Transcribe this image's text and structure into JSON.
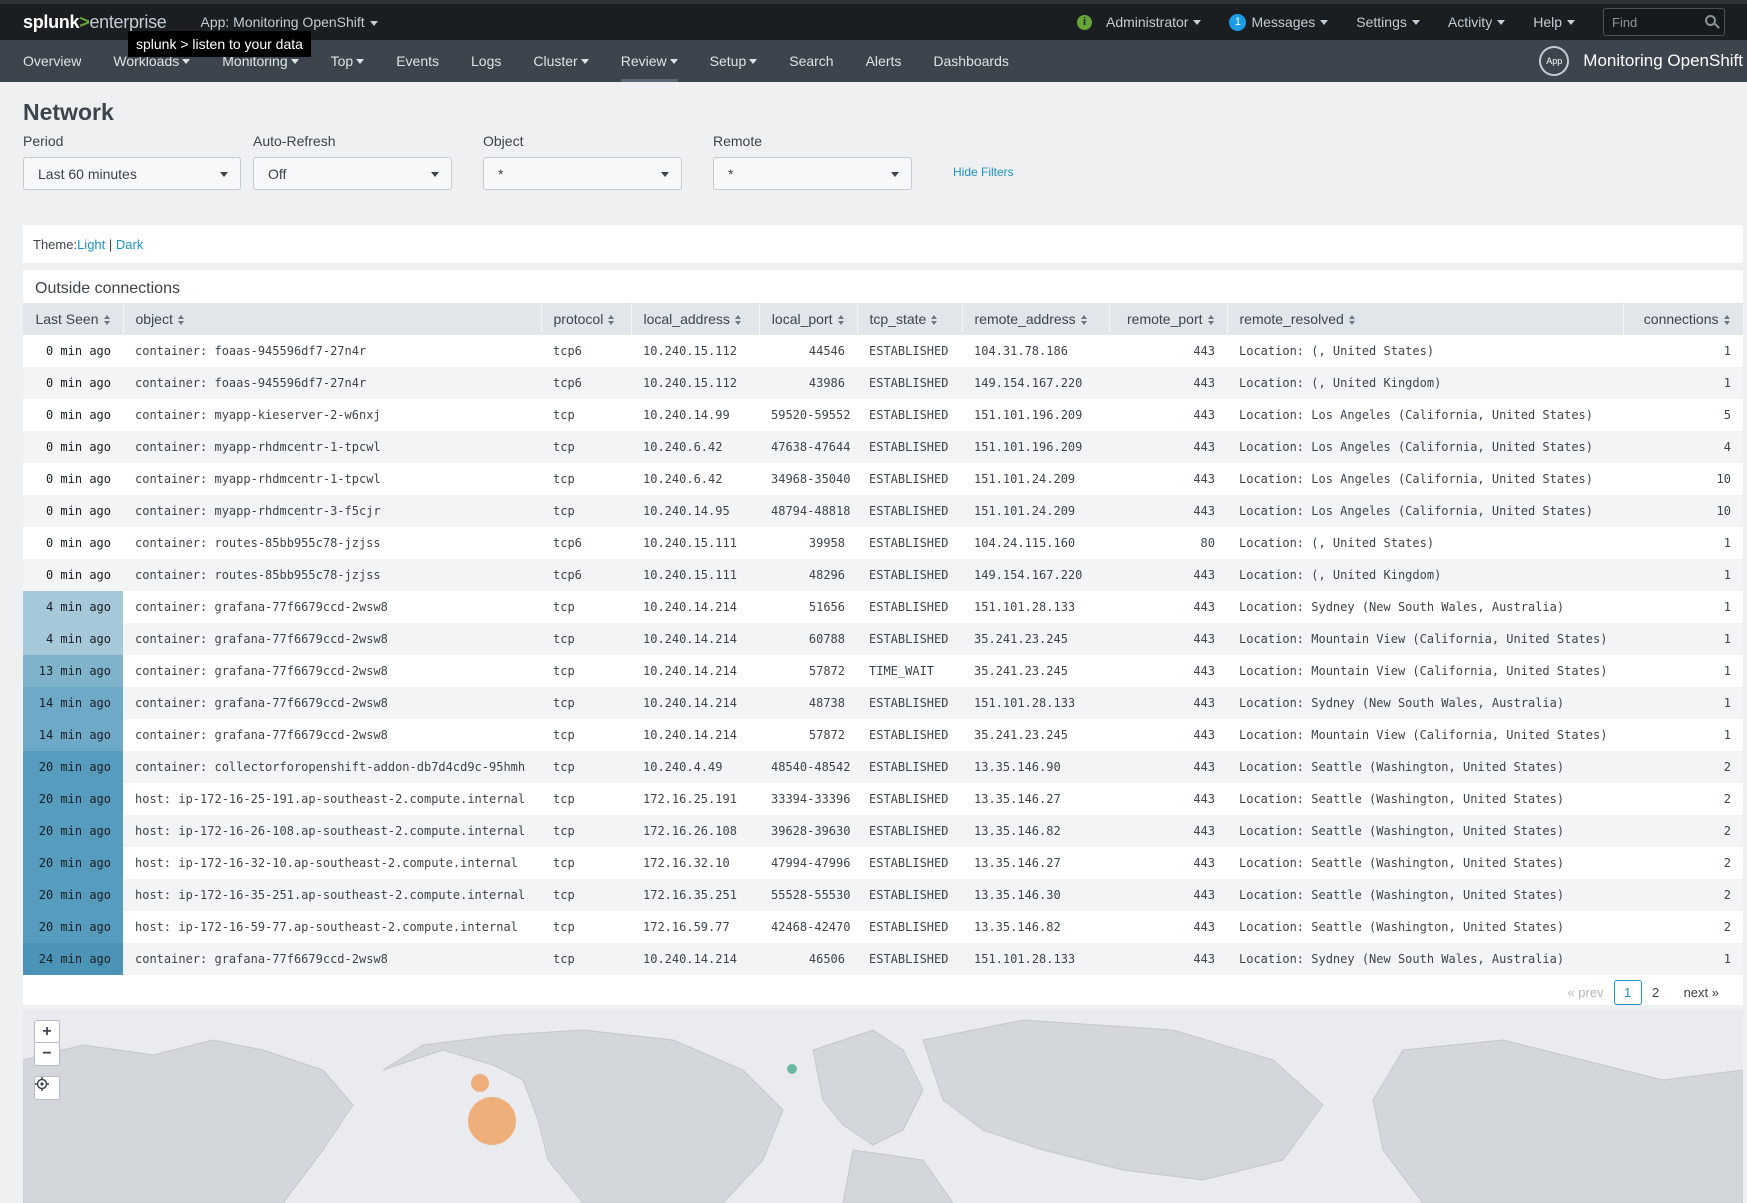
{
  "topbar": {
    "logo_main": "splunk",
    "logo_gt": ">",
    "logo_suffix": "enterprise",
    "app_label": "App: Monitoring OpenShift",
    "info_icon": "i",
    "user": "Administrator",
    "messages_count": "1",
    "messages": "Messages",
    "settings": "Settings",
    "activity": "Activity",
    "help": "Help",
    "find_placeholder": "Find"
  },
  "tooltip": "splunk > listen to your data",
  "nav": {
    "items": [
      {
        "label": "Overview",
        "caret": false
      },
      {
        "label": "Workloads",
        "caret": true
      },
      {
        "label": "Monitoring",
        "caret": true
      },
      {
        "label": "Top",
        "caret": true
      },
      {
        "label": "Events",
        "caret": false
      },
      {
        "label": "Logs",
        "caret": false
      },
      {
        "label": "Cluster",
        "caret": true
      },
      {
        "label": "Review",
        "caret": true
      },
      {
        "label": "Setup",
        "caret": true
      },
      {
        "label": "Search",
        "caret": false
      },
      {
        "label": "Alerts",
        "caret": false
      },
      {
        "label": "Dashboards",
        "caret": false
      }
    ],
    "app_badge": "App",
    "app_title": "Monitoring OpenShift"
  },
  "page": {
    "title": "Network",
    "filters": [
      {
        "label": "Period",
        "value": "Last 60 minutes"
      },
      {
        "label": "Auto-Refresh",
        "value": "Off"
      },
      {
        "label": "Object",
        "value": "*"
      },
      {
        "label": "Remote",
        "value": "*"
      }
    ],
    "hide_filters": "Hide Filters"
  },
  "theme": {
    "label": "Theme: ",
    "light": "Light",
    "separator": " | ",
    "dark": "Dark"
  },
  "table": {
    "title": "Outside connections",
    "columns": [
      "Last Seen",
      "object",
      "protocol",
      "local_address",
      "local_port",
      "tcp_state",
      "remote_address",
      "remote_port",
      "remote_resolved",
      "connections"
    ],
    "rows": [
      [
        "0 min ago",
        "container: foaas-945596df7-27n4r",
        "tcp6",
        "10.240.15.112",
        "44546",
        "ESTABLISHED",
        "104.31.78.186",
        "443",
        "Location:  (, United States)",
        "1"
      ],
      [
        "0 min ago",
        "container: foaas-945596df7-27n4r",
        "tcp6",
        "10.240.15.112",
        "43986",
        "ESTABLISHED",
        "149.154.167.220",
        "443",
        "Location:  (, United Kingdom)",
        "1"
      ],
      [
        "0 min ago",
        "container: myapp-kieserver-2-w6nxj",
        "tcp",
        "10.240.14.99",
        "59520-59552",
        "ESTABLISHED",
        "151.101.196.209",
        "443",
        "Location: Los Angeles (California, United States)",
        "5"
      ],
      [
        "0 min ago",
        "container: myapp-rhdmcentr-1-tpcwl",
        "tcp",
        "10.240.6.42",
        "47638-47644",
        "ESTABLISHED",
        "151.101.196.209",
        "443",
        "Location: Los Angeles (California, United States)",
        "4"
      ],
      [
        "0 min ago",
        "container: myapp-rhdmcentr-1-tpcwl",
        "tcp",
        "10.240.6.42",
        "34968-35040",
        "ESTABLISHED",
        "151.101.24.209",
        "443",
        "Location: Los Angeles (California, United States)",
        "10"
      ],
      [
        "0 min ago",
        "container: myapp-rhdmcentr-3-f5cjr",
        "tcp",
        "10.240.14.95",
        "48794-48818",
        "ESTABLISHED",
        "151.101.24.209",
        "443",
        "Location: Los Angeles (California, United States)",
        "10"
      ],
      [
        "0 min ago",
        "container: routes-85bb955c78-jzjss",
        "tcp6",
        "10.240.15.111",
        "39958",
        "ESTABLISHED",
        "104.24.115.160",
        "80",
        "Location:  (, United States)",
        "1"
      ],
      [
        "0 min ago",
        "container: routes-85bb955c78-jzjss",
        "tcp6",
        "10.240.15.111",
        "48296",
        "ESTABLISHED",
        "149.154.167.220",
        "443",
        "Location:  (, United Kingdom)",
        "1"
      ],
      [
        "4 min ago",
        "container: grafana-77f6679ccd-2wsw8",
        "tcp",
        "10.240.14.214",
        "51656",
        "ESTABLISHED",
        "151.101.28.133",
        "443",
        "Location: Sydney (New South Wales, Australia)",
        "1"
      ],
      [
        "4 min ago",
        "container: grafana-77f6679ccd-2wsw8",
        "tcp",
        "10.240.14.214",
        "60788",
        "ESTABLISHED",
        "35.241.23.245",
        "443",
        "Location: Mountain View (California, United States)",
        "1"
      ],
      [
        "13 min ago",
        "container: grafana-77f6679ccd-2wsw8",
        "tcp",
        "10.240.14.214",
        "57872",
        "TIME_WAIT",
        "35.241.23.245",
        "443",
        "Location: Mountain View (California, United States)",
        "1"
      ],
      [
        "14 min ago",
        "container: grafana-77f6679ccd-2wsw8",
        "tcp",
        "10.240.14.214",
        "48738",
        "ESTABLISHED",
        "151.101.28.133",
        "443",
        "Location: Sydney (New South Wales, Australia)",
        "1"
      ],
      [
        "14 min ago",
        "container: grafana-77f6679ccd-2wsw8",
        "tcp",
        "10.240.14.214",
        "57872",
        "ESTABLISHED",
        "35.241.23.245",
        "443",
        "Location: Mountain View (California, United States)",
        "1"
      ],
      [
        "20 min ago",
        "container: collectorforopenshift-addon-db7d4cd9c-95hmh",
        "tcp",
        "10.240.4.49",
        "48540-48542",
        "ESTABLISHED",
        "13.35.146.90",
        "443",
        "Location: Seattle (Washington, United States)",
        "2"
      ],
      [
        "20 min ago",
        "host: ip-172-16-25-191.ap-southeast-2.compute.internal",
        "tcp",
        "172.16.25.191",
        "33394-33396",
        "ESTABLISHED",
        "13.35.146.27",
        "443",
        "Location: Seattle (Washington, United States)",
        "2"
      ],
      [
        "20 min ago",
        "host: ip-172-16-26-108.ap-southeast-2.compute.internal",
        "tcp",
        "172.16.26.108",
        "39628-39630",
        "ESTABLISHED",
        "13.35.146.82",
        "443",
        "Location: Seattle (Washington, United States)",
        "2"
      ],
      [
        "20 min ago",
        "host: ip-172-16-32-10.ap-southeast-2.compute.internal",
        "tcp",
        "172.16.32.10",
        "47994-47996",
        "ESTABLISHED",
        "13.35.146.27",
        "443",
        "Location: Seattle (Washington, United States)",
        "2"
      ],
      [
        "20 min ago",
        "host: ip-172-16-35-251.ap-southeast-2.compute.internal",
        "tcp",
        "172.16.35.251",
        "55528-55530",
        "ESTABLISHED",
        "13.35.146.30",
        "443",
        "Location: Seattle (Washington, United States)",
        "2"
      ],
      [
        "20 min ago",
        "host: ip-172-16-59-77.ap-southeast-2.compute.internal",
        "tcp",
        "172.16.59.77",
        "42468-42470",
        "ESTABLISHED",
        "13.35.146.82",
        "443",
        "Location: Seattle (Washington, United States)",
        "2"
      ],
      [
        "24 min ago",
        "container: grafana-77f6679ccd-2wsw8",
        "tcp",
        "10.240.14.214",
        "46506",
        "ESTABLISHED",
        "151.101.28.133",
        "443",
        "Location: Sydney (New South Wales, Australia)",
        "1"
      ]
    ],
    "seen_colors": {
      "0 min ago": "",
      "4 min ago": "#a6c9da",
      "13 min ago": "#7fb3cc",
      "14 min ago": "#6eaac7",
      "20 min ago": "#569cbe",
      "24 min ago": "#4b94b8"
    },
    "pager": {
      "prev": "« prev",
      "pages": [
        "1",
        "2"
      ],
      "current": "1",
      "next": "next »"
    }
  },
  "map": {
    "zoom_in": "+",
    "zoom_out": "−",
    "locate_icon": "crosshair-icon",
    "marker_colors": {
      "orange": "#f0a86e",
      "teal": "#5bb49a"
    }
  }
}
